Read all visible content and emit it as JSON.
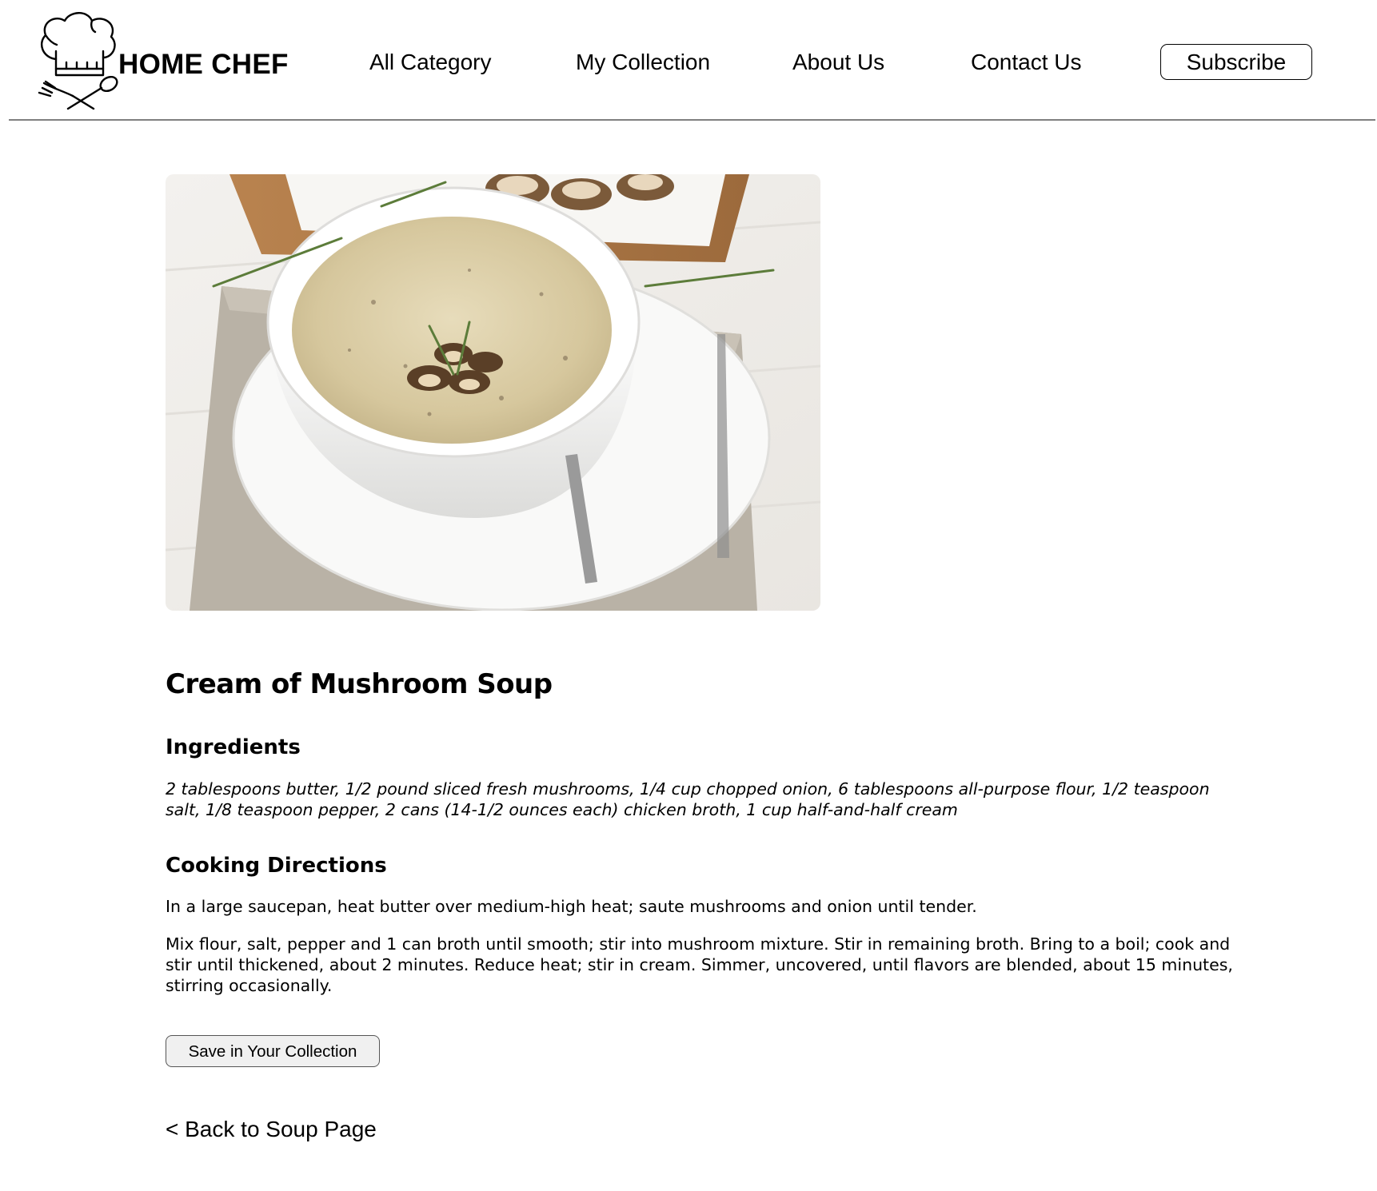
{
  "brand": {
    "name": "HOME CHEF",
    "logo_icon": "chef-hat-fork-spoon-icon"
  },
  "nav": {
    "items": [
      {
        "label": "All Category"
      },
      {
        "label": "My Collection"
      },
      {
        "label": "About Us"
      },
      {
        "label": "Contact Us"
      }
    ],
    "subscribe_label": "Subscribe"
  },
  "hero": {
    "image_subject": "bowl-of-cream-of-mushroom-soup"
  },
  "recipe": {
    "title": "Cream of Mushroom Soup",
    "ingredients_heading": "Ingredients",
    "ingredients": "2 tablespoons butter, 1/2 pound sliced fresh mushrooms, 1/4 cup chopped onion, 6 tablespoons all-purpose flour, 1/2 teaspoon salt, 1/8 teaspoon pepper, 2 cans (14-1/2 ounces each) chicken broth, 1 cup half-and-half cream",
    "directions_heading": "Cooking Directions",
    "directions": [
      "In a large saucepan, heat butter over medium-high heat; saute mushrooms and onion until tender.",
      "Mix flour, salt, pepper and 1 can broth until smooth; stir into mushroom mixture. Stir in remaining broth. Bring to a boil; cook and stir until thickened, about 2 minutes. Reduce heat; stir in cream. Simmer, uncovered, until flavors are blended, about 15 minutes, stirring occasionally."
    ],
    "save_label": "Save in Your Collection",
    "back_label": "< Back to Soup Page"
  },
  "colors": {
    "text": "#000000",
    "divider": "#808080",
    "button_bg": "#f0f0f0"
  }
}
